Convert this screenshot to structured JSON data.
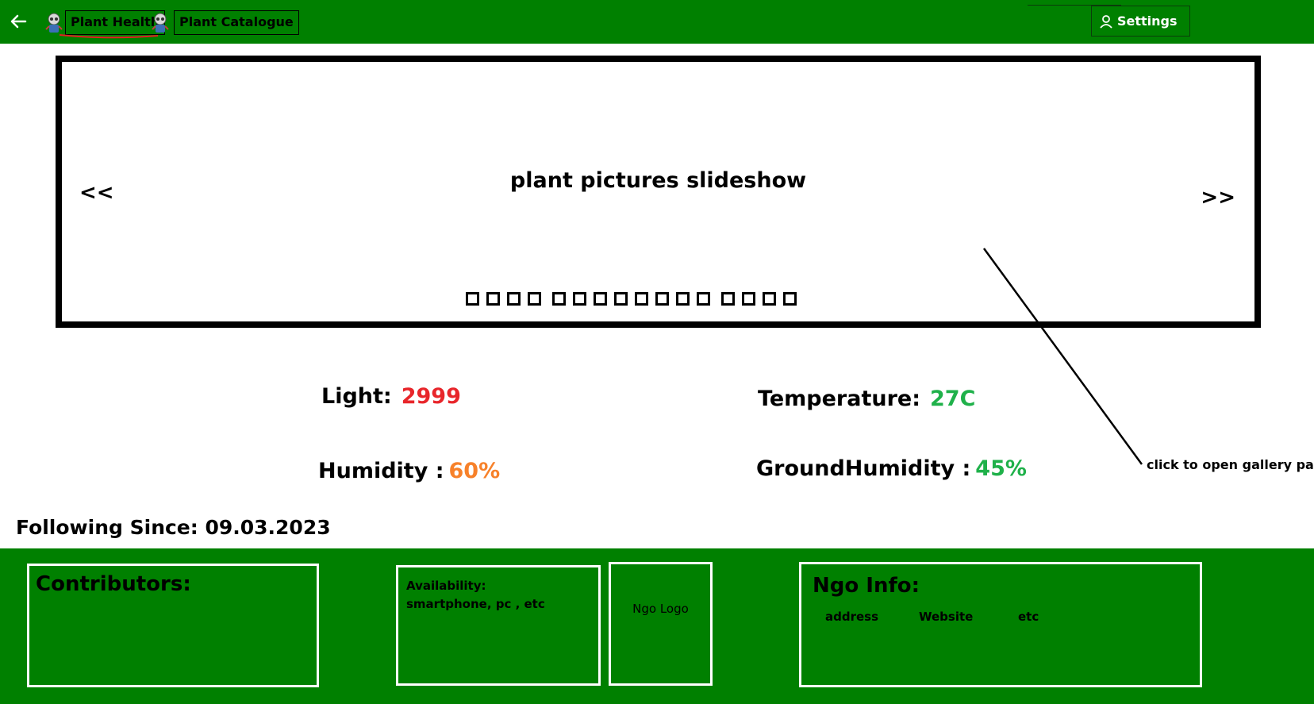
{
  "colors": {
    "brand": "#008000",
    "red": "#e8262b",
    "green": "#1fb14a",
    "orange": "#f7812a"
  },
  "header": {
    "back_icon": "left-arrow-icon",
    "tab_icon": "plant-robot-icon",
    "tabs": [
      {
        "label": "Plant Health",
        "active": true
      },
      {
        "label": "Plant Catalogue",
        "active": false
      }
    ],
    "settings": {
      "label": "Settings",
      "icon": "user-icon"
    }
  },
  "slideshow": {
    "title": "plant pictures slideshow",
    "prev": "<<",
    "next": ">>",
    "thumbnail_count": 16
  },
  "gallery_hint": "click to open gallery page",
  "metrics": {
    "light": {
      "label": "Light:",
      "value": "2999"
    },
    "temperature": {
      "label": "Temperature:",
      "value": "27C"
    },
    "humidity": {
      "label": "Humidity :",
      "value": "60%"
    },
    "ground_humidity": {
      "label": "GroundHumidity :",
      "value": "45%"
    }
  },
  "following_since": "Following Since: 09.03.2023",
  "footer": {
    "contributors": {
      "title": "Contributors:"
    },
    "availability": {
      "title": "Availability:",
      "text": "smartphone, pc , etc"
    },
    "ngo_logo": {
      "label": "Ngo Logo"
    },
    "ngo_info": {
      "title": "Ngo Info:",
      "items": [
        "address",
        "Website",
        "etc"
      ]
    }
  }
}
